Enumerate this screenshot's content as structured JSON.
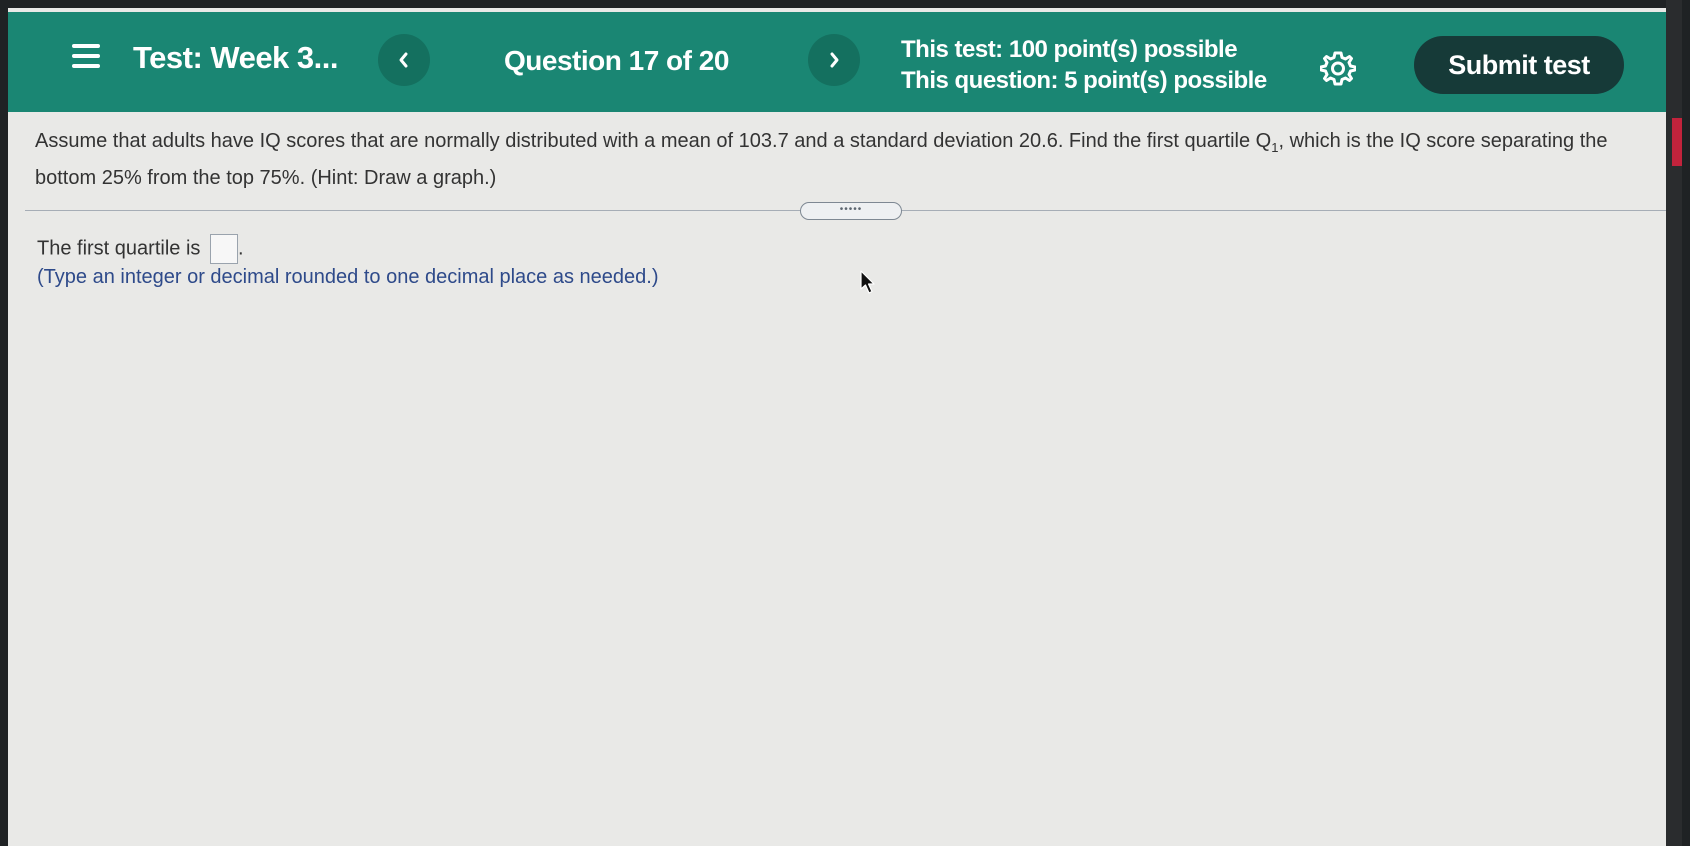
{
  "header": {
    "test_title": "Test: Week 3...",
    "question_counter": "Question 17 of 20",
    "test_points": "This test: 100 point(s) possible",
    "question_points": "This question: 5 point(s) possible",
    "submit_label": "Submit test",
    "background_color": "#1a8673",
    "submit_color": "#163a38"
  },
  "question": {
    "text_before_sub": "Assume that adults have IQ scores that are normally distributed with a mean of 103.7 and a standard deviation 20.6. Find the first quartile Q",
    "subscript": "1",
    "text_after_sub": ", which is the IQ score separating the bottom 25% from the top 75%. (Hint: Draw a graph.)"
  },
  "answer": {
    "prompt": "The first quartile is",
    "suffix": ".",
    "value": "",
    "hint": "(Type an integer or decimal rounded to one decimal place as needed.)"
  },
  "icons": {
    "menu": "hamburger-menu-icon",
    "prev": "chevron-left-icon",
    "next": "chevron-right-icon",
    "settings": "gear-icon",
    "cursor": "mouse-pointer-icon"
  }
}
